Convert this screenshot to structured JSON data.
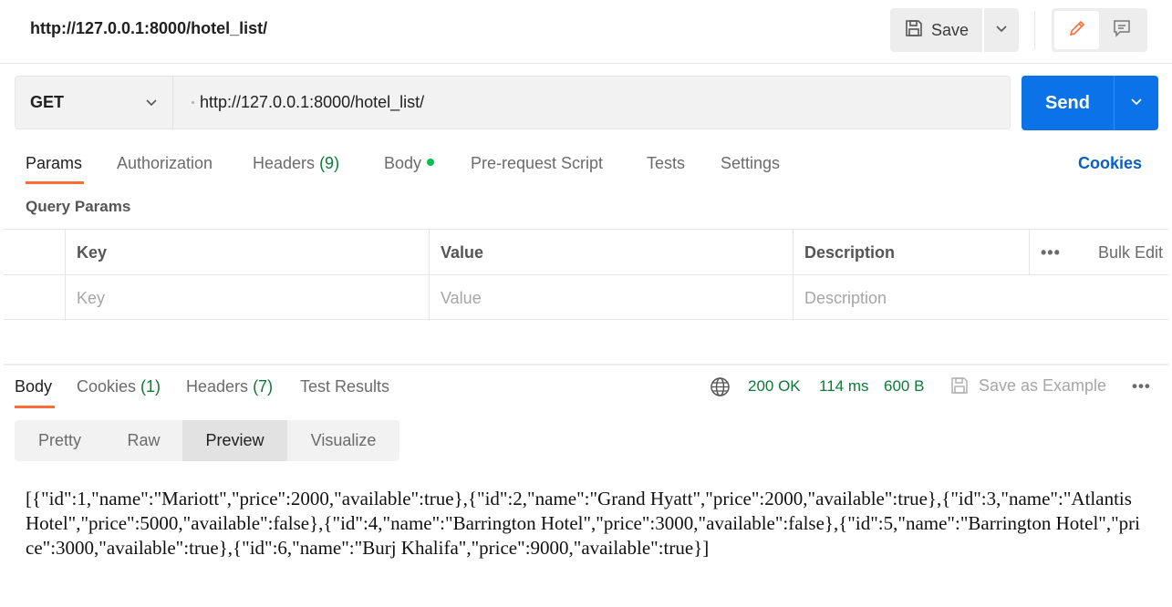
{
  "header": {
    "title": "http://127.0.0.1:8000/hotel_list/",
    "save_label": "Save",
    "icons": {
      "save": "save-icon",
      "caret": "chevron-down-icon",
      "edit": "pencil-icon",
      "comments": "comment-icon"
    }
  },
  "request": {
    "method": "GET",
    "url": "http://127.0.0.1:8000/hotel_list/",
    "send_label": "Send"
  },
  "request_tabs": [
    {
      "label": "Params",
      "count": "",
      "active": true
    },
    {
      "label": "Authorization",
      "count": ""
    },
    {
      "label": "Headers",
      "count": "(9)"
    },
    {
      "label": "Body",
      "count": "",
      "indicator": true
    },
    {
      "label": "Pre-request Script",
      "count": ""
    },
    {
      "label": "Tests",
      "count": ""
    },
    {
      "label": "Settings",
      "count": ""
    }
  ],
  "cookies_link": "Cookies",
  "query_params": {
    "label": "Query Params",
    "headers": {
      "key": "Key",
      "value": "Value",
      "description": "Description",
      "bulk_edit": "Bulk Edit",
      "more": "•••"
    },
    "placeholders": {
      "key": "Key",
      "value": "Value",
      "description": "Description"
    }
  },
  "response_tabs": [
    {
      "label": "Body",
      "count": "",
      "active": true
    },
    {
      "label": "Cookies",
      "count": "(1)"
    },
    {
      "label": "Headers",
      "count": "(7)"
    },
    {
      "label": "Test Results",
      "count": ""
    }
  ],
  "response_meta": {
    "status": "200 OK",
    "time": "114 ms",
    "size": "600 B",
    "save_example": "Save as Example",
    "more": "•••",
    "icons": {
      "network": "globe-icon",
      "save": "save-icon"
    }
  },
  "view_modes": [
    {
      "label": "Pretty"
    },
    {
      "label": "Raw"
    },
    {
      "label": "Preview",
      "active": true
    },
    {
      "label": "Visualize"
    }
  ],
  "response_body": "[{\"id\":1,\"name\":\"Mariott\",\"price\":2000,\"available\":true},{\"id\":2,\"name\":\"Grand Hyatt\",\"price\":2000,\"available\":true},{\"id\":3,\"name\":\"Atlantis Hotel\",\"price\":5000,\"available\":false},{\"id\":4,\"name\":\"Barrington Hotel\",\"price\":3000,\"available\":false},{\"id\":5,\"name\":\"Barrington Hotel\",\"price\":3000,\"available\":true},{\"id\":6,\"name\":\"Burj Khalifa\",\"price\":9000,\"available\":true}]",
  "colors": {
    "accent": "#ff6c37",
    "send": "#0b72e7",
    "status_ok": "#0c7a37",
    "link": "#0b5fc4",
    "body_indicator": "#0cbb52"
  }
}
